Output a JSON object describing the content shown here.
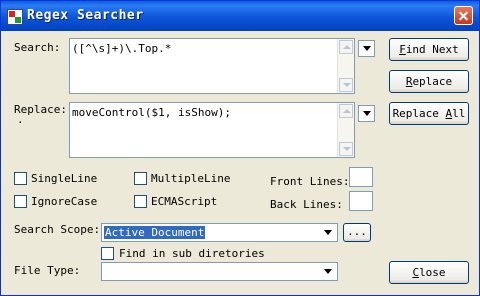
{
  "window": {
    "title": "Regex Searcher"
  },
  "search": {
    "label": "Search:",
    "value": "([^\\s]+)\\.Top.*"
  },
  "replace": {
    "label": "Replace:",
    "label_suffix": ".",
    "value": "moveControl($1, isShow);"
  },
  "buttons": {
    "find_next": {
      "key": "F",
      "rest": "ind Next"
    },
    "replace": {
      "key": "R",
      "rest": "eplace"
    },
    "replace_all": {
      "pre": "Replace ",
      "key": "A",
      "rest": "ll"
    },
    "close": {
      "key": "C",
      "rest": "lose"
    }
  },
  "options": {
    "singleline": "SingleLine",
    "multipleline": "MultipleLine",
    "ignorecase": "IgnoreCase",
    "ecmascript": "ECMAScript"
  },
  "lines": {
    "front_label": "Front Lines:",
    "back_label": "Back Lines:"
  },
  "scope": {
    "label": "Search Scope:",
    "value": "Active Document",
    "browse": "..."
  },
  "subdirs": {
    "label": "Find in sub diretories"
  },
  "filetype": {
    "label": "File Type:"
  }
}
